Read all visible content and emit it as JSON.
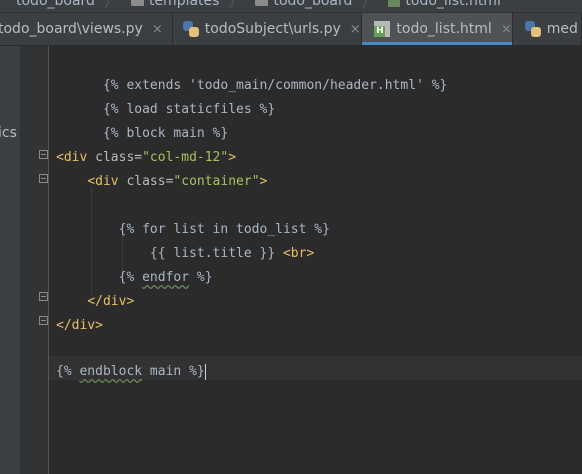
{
  "breadcrumb": {
    "items": [
      {
        "label": "todo_board"
      },
      {
        "label": "templates"
      },
      {
        "label": "todo_board"
      },
      {
        "label": "todo_list.html"
      }
    ],
    "separator": "〉"
  },
  "tabs": [
    {
      "label": "todo_board\\views.py",
      "icon": "python-file-icon",
      "close": "×"
    },
    {
      "label": "todoSubject\\urls.py",
      "icon": "python-file-icon",
      "close": "×"
    },
    {
      "label": "todo_list.html",
      "icon": "html-file-icon",
      "close": "×",
      "active": true
    },
    {
      "label": "med",
      "icon": "python-file-icon"
    }
  ],
  "left_panel": {
    "text": "ics"
  },
  "code": {
    "line1": {
      "text": "{% extends 'todo_main/common/header.html' %}"
    },
    "line2": {
      "text": "{% load staticfiles %}"
    },
    "line3": {
      "text": "{% block main %}"
    },
    "line5": {
      "open": "<div ",
      "attr": "class=",
      "val": "\"col-md-12\"",
      "close": ">"
    },
    "line6": {
      "indent": "    ",
      "open": "<div ",
      "attr": "class=",
      "val": "\"container\"",
      "close": ">"
    },
    "line8": {
      "indent": "        ",
      "text": "{% for list in todo_list %}"
    },
    "line9": {
      "indent": "            ",
      "text": "{{ list.title }} ",
      "tag": "<br>"
    },
    "line10": {
      "indent": "        ",
      "pre": "{% ",
      "kw": "endfor",
      "post": " %}"
    },
    "line11": {
      "indent": "    ",
      "tag": "</div>"
    },
    "line12": {
      "tag": "</div>"
    },
    "line14": {
      "pre": "{% ",
      "kw": "endblock",
      "post": " main %}"
    }
  },
  "colors": {
    "background": "#2b2b2b",
    "tag": "#e8bf6a",
    "string": "#a5c261",
    "text": "#a9b7c6",
    "active_tab_underline": "#4a88c7"
  }
}
